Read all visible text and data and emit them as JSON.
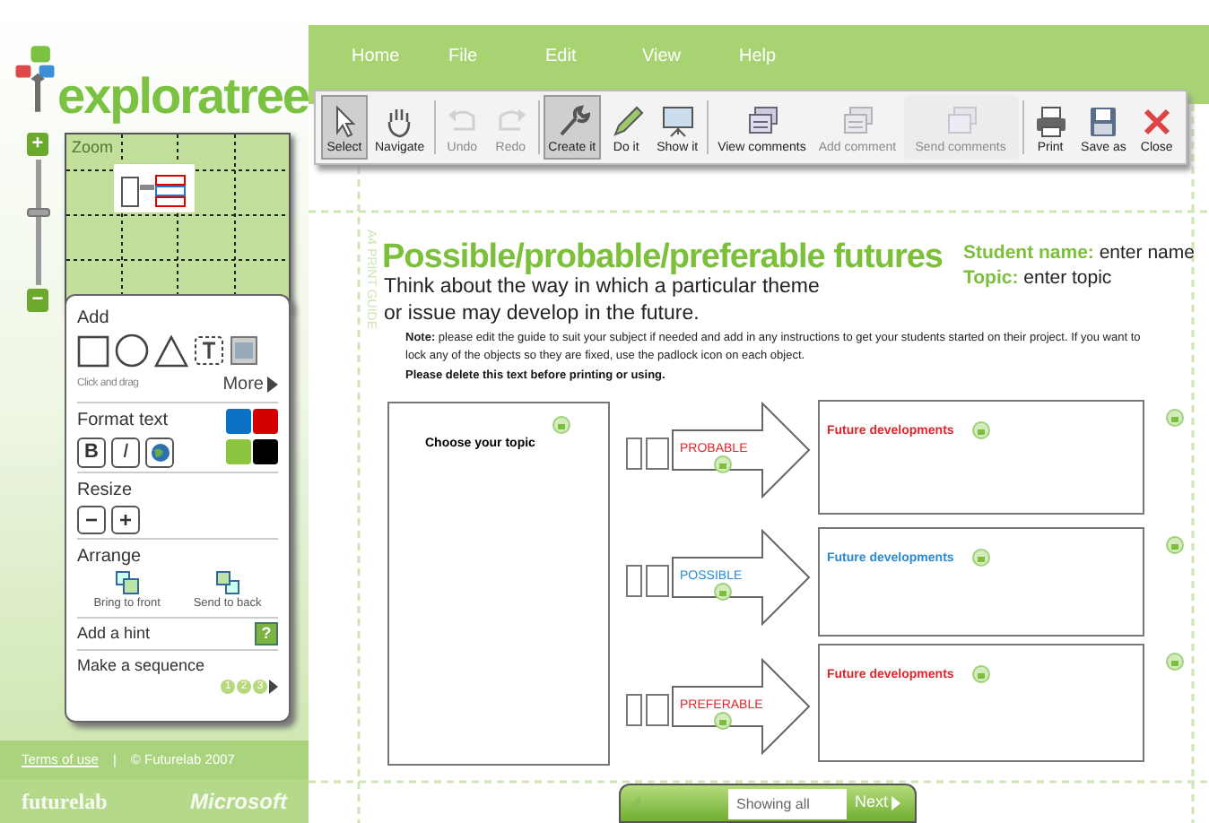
{
  "logo": {
    "text": "exploratree"
  },
  "zoom": {
    "label": "Zoom",
    "level": 0.55,
    "zoom_in": "+",
    "zoom_out": "−"
  },
  "tools": {
    "add": {
      "title": "Add",
      "hint": "Click and drag",
      "more": "More"
    },
    "format_text": {
      "title": "Format text",
      "bold": "B",
      "italic": "I",
      "colors": [
        {
          "color": "#0a72c4"
        },
        {
          "color": "#d40000"
        },
        {
          "color": "#8cc43f"
        },
        {
          "color": "#000000"
        }
      ]
    },
    "resize": {
      "title": "Resize",
      "smaller": "−",
      "larger": "+"
    },
    "arrange": {
      "title": "Arrange",
      "front": "Bring to front",
      "back": "Send to back"
    },
    "hint": {
      "title": "Add a hint",
      "button": "?"
    },
    "sequence": {
      "title": "Make a sequence",
      "steps": [
        "1",
        "2",
        "3"
      ]
    }
  },
  "footer": {
    "terms": "Terms of use",
    "separator": "|",
    "copyright": "© Futurelab 2007",
    "logo_left": "futurelab",
    "logo_right": "Microsoft"
  },
  "menu": [
    "Home",
    "File",
    "Edit",
    "View",
    "Help"
  ],
  "toolbar": [
    {
      "label": "Select",
      "kind": "pointer",
      "selected": true,
      "disabled": false,
      "divider": false
    },
    {
      "label": "Navigate",
      "kind": "hand",
      "selected": false,
      "disabled": false,
      "divider": true
    },
    {
      "label": "Undo",
      "kind": "undo",
      "selected": false,
      "disabled": true,
      "divider": false
    },
    {
      "label": "Redo",
      "kind": "redo",
      "selected": false,
      "disabled": true,
      "divider": true
    },
    {
      "label": "Create it",
      "kind": "wrench",
      "selected": true,
      "disabled": false,
      "divider": false
    },
    {
      "label": "Do it",
      "kind": "pencil",
      "selected": false,
      "disabled": false,
      "divider": false
    },
    {
      "label": "Show it",
      "kind": "screen",
      "selected": false,
      "disabled": false,
      "divider": true
    },
    {
      "label": "View comments",
      "kind": "comments",
      "selected": false,
      "disabled": false,
      "divider": false
    },
    {
      "label": "Add comment",
      "kind": "comments",
      "selected": false,
      "disabled": true,
      "divider": false
    },
    {
      "label": "Send comments",
      "kind": "send",
      "selected": false,
      "disabled": true,
      "divider": true
    },
    {
      "label": "Print",
      "kind": "printer",
      "selected": false,
      "disabled": false,
      "divider": false
    },
    {
      "label": "Save as",
      "kind": "disk",
      "selected": false,
      "disabled": false,
      "divider": false
    },
    {
      "label": "Close",
      "kind": "cross",
      "selected": false,
      "disabled": false,
      "divider": false
    }
  ],
  "document": {
    "guide": "A4 PRINT GUIDE",
    "title": "Possible/probable/preferable futures",
    "intro": [
      "Think about the way in which a particular theme",
      "or issue may develop in the future."
    ],
    "student_label": "Student name:",
    "student_value": "enter name",
    "topic_label": "Topic:",
    "topic_value": "enter topic",
    "note": "**Note:** please edit the guide to suit your subject if needed and add in any instructions  to get your students started on their project. If you want to lock any of the objects so they are fixed, use the padlock icon on each object.",
    "warning": "Please delete this text before printing or using.",
    "topic_box": "Choose your topic",
    "rows": [
      {
        "arrow": "PROBABLE",
        "color": "#e0262b",
        "box": "Future developments"
      },
      {
        "arrow": "POSSIBLE",
        "color": "#2a8ad4",
        "box": "Future developments"
      },
      {
        "arrow": "PREFERABLE",
        "color": "#e0262b",
        "box": "Future developments"
      }
    ]
  },
  "pager": {
    "value": "Showing all",
    "next": "Next"
  }
}
